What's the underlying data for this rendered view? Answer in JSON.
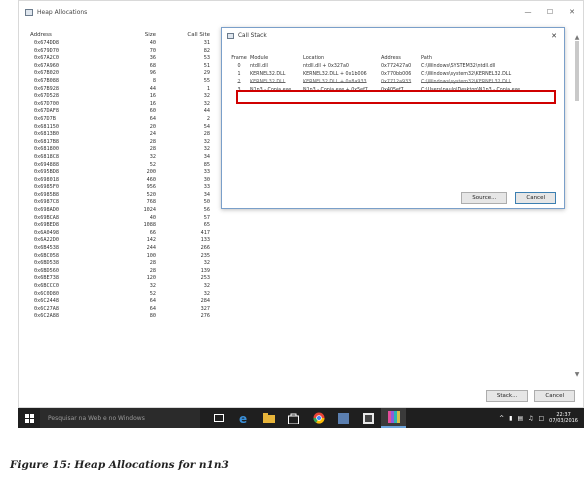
{
  "window": {
    "title": "Heap Allocations",
    "columns": {
      "address": "Address",
      "size": "Size",
      "call_site": "Call Site"
    },
    "rows": [
      {
        "address": "0x674DD8",
        "size": "40",
        "site": "31"
      },
      {
        "address": "0x679D70",
        "size": "70",
        "site": "82"
      },
      {
        "address": "0x67A2C0",
        "size": "36",
        "site": "53"
      },
      {
        "address": "0x67A960",
        "size": "68",
        "site": "51"
      },
      {
        "address": "0x67B020",
        "size": "96",
        "site": "29"
      },
      {
        "address": "0x67B088",
        "size": "8",
        "site": "55"
      },
      {
        "address": "0x67B928",
        "size": "44",
        "site": "1"
      },
      {
        "address": "0x67D528",
        "size": "16",
        "site": "32"
      },
      {
        "address": "0x67D700",
        "size": "16",
        "site": "32"
      },
      {
        "address": "0x67DAF8",
        "size": "60",
        "site": "44"
      },
      {
        "address": "0x67D7B",
        "size": "64",
        "site": "2"
      },
      {
        "address": "0x681150",
        "size": "20",
        "site": "54"
      },
      {
        "address": "0x6813B0",
        "size": "24",
        "site": "28"
      },
      {
        "address": "0x6817B8",
        "size": "28",
        "site": "32"
      },
      {
        "address": "0x681800",
        "size": "28",
        "site": "32"
      },
      {
        "address": "0x6818C8",
        "size": "32",
        "site": "34"
      },
      {
        "address": "0x694888",
        "size": "52",
        "site": "85"
      },
      {
        "address": "0x695BD8",
        "size": "200",
        "site": "33"
      },
      {
        "address": "0x698018",
        "size": "460",
        "site": "30"
      },
      {
        "address": "0x6985F0",
        "size": "956",
        "site": "33"
      },
      {
        "address": "0x6985B8",
        "size": "520",
        "site": "34"
      },
      {
        "address": "0x6987C8",
        "size": "768",
        "site": "50"
      },
      {
        "address": "0x698AD0",
        "size": "1024",
        "site": "56"
      },
      {
        "address": "0x69BCA8",
        "size": "40",
        "site": "57"
      },
      {
        "address": "0x69BED8",
        "size": "1088",
        "site": "65"
      },
      {
        "address": "0x6A0498",
        "size": "66",
        "site": "417"
      },
      {
        "address": "0x6A22D0",
        "size": "142",
        "site": "133"
      },
      {
        "address": "0x6B4538",
        "size": "244",
        "site": "266"
      },
      {
        "address": "0x6BC058",
        "size": "100",
        "site": "235"
      },
      {
        "address": "0x6BD538",
        "size": "28",
        "site": "32"
      },
      {
        "address": "0x6BD560",
        "size": "28",
        "site": "139"
      },
      {
        "address": "0x6BE738",
        "size": "120",
        "site": "253"
      },
      {
        "address": "0x6BCCC0",
        "size": "32",
        "site": "32"
      },
      {
        "address": "0x6C0D80",
        "size": "52",
        "site": "32"
      },
      {
        "address": "0x6C2448",
        "size": "64",
        "site": "284"
      },
      {
        "address": "0x6C27A8",
        "size": "64",
        "site": "327"
      },
      {
        "address": "0x6C2A88",
        "size": "80",
        "site": "276"
      }
    ],
    "buttons": {
      "stack": "Stack...",
      "cancel": "Cancel"
    }
  },
  "dialog": {
    "title": "Call Stack",
    "columns": {
      "frame": "Frame",
      "module": "Module",
      "location": "Location",
      "address": "Address",
      "path": "Path"
    },
    "rows": [
      {
        "frame": "0",
        "module": "ntdll.dll",
        "location": "ntdll.dll + 0x327a0",
        "address": "0x772427a0",
        "path": "C:\\Windows\\SYSTEM32\\ntdll.dll"
      },
      {
        "frame": "1",
        "module": "KERNEL32.DLL",
        "location": "KERNEL32.DLL + 0x1b006",
        "address": "0x770bb006",
        "path": "C:\\Windows\\system32\\KERNEL32.DLL"
      },
      {
        "frame": "2",
        "module": "KERNEL32.DLL",
        "location": "KERNEL32.DLL + 0x8a933",
        "address": "0x7712a933",
        "path": "C:\\Windows\\system32\\KERNEL32.DLL"
      },
      {
        "frame": "3",
        "module": "N1n3 - Copia.exe",
        "location": "N1n3 - Copia.exe + 0x5ef7",
        "address": "0x405ef7",
        "path": "C:\\Users\\paulo\\Desktop\\N1n3 - Copia.exe"
      }
    ],
    "buttons": {
      "source": "Source...",
      "cancel": "Cancel"
    },
    "highlight_color": "#d00000"
  },
  "taskbar": {
    "search_placeholder": "Pesquisar na Web e no Windows",
    "time": "22:37",
    "date": "07/03/2016",
    "apps": [
      "task-view-icon",
      "edge-icon",
      "file-explorer-icon",
      "store-icon",
      "chrome-icon",
      "app-icon",
      "app-icon-2",
      "app-icon-3"
    ]
  },
  "caption": "Figure 15: Heap Allocations for n1n3"
}
